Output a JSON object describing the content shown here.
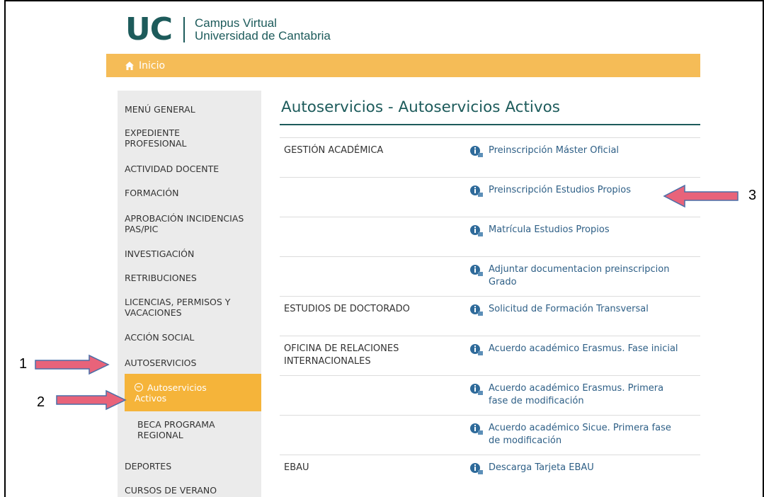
{
  "header": {
    "logo": "UC",
    "line1": "Campus Virtual",
    "line2": "Universidad de Cantabria"
  },
  "breadcrumb": {
    "label": "Inicio",
    "icon": "home-icon"
  },
  "sidebar": {
    "items": [
      "MENÚ GENERAL",
      "EXPEDIENTE PROFESIONAL",
      "ACTIVIDAD DOCENTE",
      "FORMACIÓN",
      "APROBACIÓN INCIDENCIAS PAS/PIC",
      "INVESTIGACIÓN",
      "RETRIBUCIONES",
      "LICENCIAS, PERMISOS Y VACACIONES",
      "ACCIÓN SOCIAL",
      "AUTOSERVICIOS"
    ],
    "sub_active": "Autoservicios Activos",
    "sub_other": "BECA PROGRAMA REGIONAL",
    "after": [
      "DEPORTES",
      "CURSOS DE VERANO"
    ]
  },
  "main": {
    "title": "Autoservicios - Autoservicios Activos",
    "rows": [
      {
        "category": "GESTIÓN ACADÉMICA",
        "link": "Preinscripción Máster Oficial"
      },
      {
        "category": "",
        "link": "Preinscripción Estudios Propios"
      },
      {
        "category": "",
        "link": "Matrícula Estudios Propios"
      },
      {
        "category": "",
        "link": "Adjuntar documentacion preinscripcion Grado"
      },
      {
        "category": "ESTUDIOS DE DOCTORADO",
        "link": "Solicitud de Formación Transversal"
      },
      {
        "category": "OFICINA DE RELACIONES INTERNACIONALES",
        "link": "Acuerdo académico Erasmus. Fase inicial"
      },
      {
        "category": "",
        "link": "Acuerdo académico Erasmus. Primera fase de modificación"
      },
      {
        "category": "",
        "link": "Acuerdo académico Sicue. Primera fase de modificación"
      },
      {
        "category": "EBAU",
        "link": "Descarga Tarjeta EBAU"
      }
    ]
  },
  "annotations": {
    "n1": "1",
    "n2": "2",
    "n3": "3"
  },
  "colors": {
    "accent": "#f5bc57",
    "active": "#f5b43a",
    "brand": "#1d5b5b",
    "link": "#2e5f86",
    "arrow": "#e8637a"
  }
}
